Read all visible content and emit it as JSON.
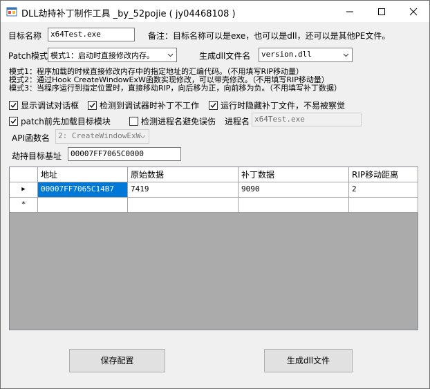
{
  "window": {
    "title": "DLL劫持补丁制作工具 _by_52pojie ( jy04468108 )"
  },
  "form": {
    "target_label": "目标名称",
    "target_value": "x64Test.exe",
    "note": "备注：目标名称可以是exe，也可以是dll，还可以是其他PE文件。",
    "patch_mode_label": "Patch模式",
    "patch_mode_value": "模式1：启动时直接修改内存。",
    "dll_name_label": "生成dll文件名",
    "dll_name_value": "version.dll",
    "mode_desc": [
      "模式1：程序加载的时候直接修改内存中的指定地址的汇编代码。（不用填写RIP移动量）",
      "模式2：通过Hook CreateWindowExW函数实现修改，可以带壳修改。（不用填写RIP移动量）",
      "模式3：当程序运行到指定位置时，直接移动RIP，向后移为正，向前移为负。（不用填写补丁数据）"
    ],
    "checkboxes": [
      {
        "label": "显示调试对话框",
        "checked": true
      },
      {
        "label": "检测到调试器时补丁不工作",
        "checked": true
      },
      {
        "label": "运行时隐藏补丁文件，不易被察觉",
        "checked": true
      },
      {
        "label": "patch前先加载目标模块",
        "checked": true
      },
      {
        "label": "检测进程名避免误伤",
        "checked": false
      }
    ],
    "process_label": "进程名",
    "process_value": "x64Test.exe",
    "api_label": "API函数名",
    "api_value": "2: CreateWindowExW",
    "hijack_base_label": "劫持目标基址",
    "hijack_base_value": "00007FF7065C0000"
  },
  "grid": {
    "columns": [
      "地址",
      "原始数据",
      "补丁数据",
      "RIP移动距离"
    ],
    "rows": [
      [
        "00007FF7065C14B7",
        "7419",
        "9090",
        "2"
      ],
      [
        "",
        "",
        "",
        ""
      ]
    ],
    "row_markers": [
      "▶",
      "*"
    ]
  },
  "buttons": {
    "save": "保存配置",
    "generate": "生成dll文件"
  },
  "icons": {
    "app": "app-window-icon",
    "minimize": "minimize-icon",
    "maximize": "maximize-icon",
    "close": "close-icon"
  }
}
